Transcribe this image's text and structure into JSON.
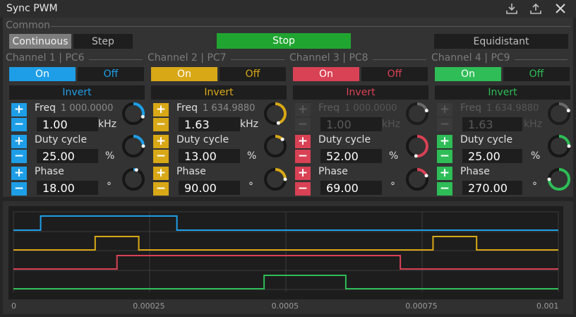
{
  "window": {
    "title": "Sync PWM"
  },
  "common": {
    "label": "Common",
    "continuous_label": "Continuous",
    "step_label": "Step",
    "stop_label": "Stop",
    "equidistant_label": "Equidistant"
  },
  "labels": {
    "on": "On",
    "off": "Off",
    "invert": "Invert",
    "freq": "Freq",
    "duty": "Duty cycle",
    "phase": "Phase",
    "khz": "kHz",
    "percent": "%",
    "degree": "°",
    "plus": "+",
    "minus": "−"
  },
  "channels": [
    {
      "title": "Channel 1 | PC6",
      "color": "#1e9ee6",
      "freq_display": "1 000.0000",
      "freq": "1.00",
      "duty": "25.00",
      "phase": "18.00",
      "freq_level": 0.3,
      "duty_level": 0.25,
      "phase_level": 0.05,
      "freq_enabled": true
    },
    {
      "title": "Channel 2 | PC7",
      "color": "#d8a817",
      "freq_display": "1 634.9880",
      "freq": "1.63",
      "duty": "13.00",
      "phase": "90.00",
      "freq_level": 0.45,
      "duty_level": 0.13,
      "phase_level": 0.25,
      "freq_enabled": true
    },
    {
      "title": "Channel 3 | PC8",
      "color": "#d94155",
      "freq_display": "1 000.0000",
      "freq": "1.00",
      "duty": "52.00",
      "phase": "69.00",
      "freq_level": 0.2,
      "duty_level": 0.52,
      "phase_level": 0.19,
      "freq_enabled": false
    },
    {
      "title": "Channel 4 | PC9",
      "color": "#2ebd57",
      "freq_display": "1 634.9880",
      "freq": "1.63",
      "duty": "25.00",
      "phase": "270.00",
      "freq_level": 0.2,
      "duty_level": 0.25,
      "phase_level": 0.75,
      "freq_enabled": false
    }
  ],
  "colors": {
    "stop": "#20a530",
    "on_text": "#ffffff"
  },
  "chart_data": {
    "type": "line",
    "title": "",
    "xlabel": "",
    "ylabel": "",
    "xlim": [
      0,
      0.001
    ],
    "x_ticks": [
      "0",
      "0.00025",
      "0.0005",
      "0.00075",
      "0.001"
    ],
    "series": [
      {
        "color": "#1e9ee6",
        "x": [
          0,
          5e-05,
          5e-05,
          0.0003,
          0.0003,
          0.001
        ],
        "y": [
          0,
          0,
          1,
          1,
          0,
          0
        ]
      },
      {
        "color": "#d8a817",
        "x": [
          0,
          0.00015,
          0.00015,
          0.00023,
          0.00023,
          0.00077,
          0.00077,
          0.00085,
          0.00085,
          0.001
        ],
        "y": [
          0,
          0,
          1,
          1,
          0,
          0,
          1,
          1,
          0,
          0
        ]
      },
      {
        "color": "#d94155",
        "x": [
          0,
          0.00019,
          0.00019,
          0.00071,
          0.00071,
          0.001
        ],
        "y": [
          0,
          0,
          1,
          1,
          0,
          0
        ]
      },
      {
        "color": "#2ebd57",
        "x": [
          0,
          0.00046,
          0.00046,
          0.00061,
          0.00061,
          0.001
        ],
        "y": [
          0,
          0,
          1,
          1,
          0,
          0
        ]
      }
    ]
  }
}
